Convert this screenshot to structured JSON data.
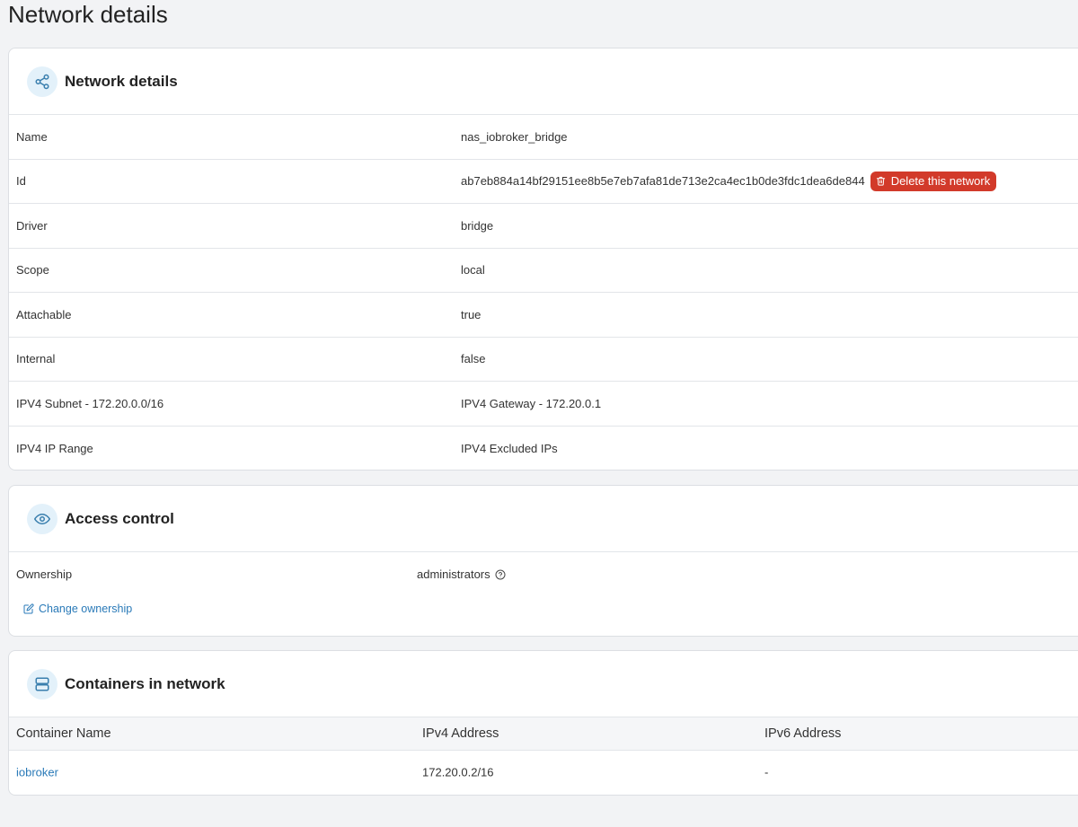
{
  "page": {
    "title": "Network details"
  },
  "network_details": {
    "title": "Network details",
    "icon": "share-nodes-icon",
    "rows": [
      {
        "key": "Name",
        "value": "nas_iobroker_bridge"
      },
      {
        "key": "Id",
        "value": "ab7eb884a14bf29151ee8b5e7eb7afa81de713e2ca4ec1b0de3fdc1dea6de844"
      },
      {
        "key": "Driver",
        "value": "bridge"
      },
      {
        "key": "Scope",
        "value": "local"
      },
      {
        "key": "Attachable",
        "value": "true"
      },
      {
        "key": "Internal",
        "value": "false"
      },
      {
        "key": "IPV4 Subnet - 172.20.0.0/16",
        "value": "IPV4 Gateway - 172.20.0.1"
      },
      {
        "key": "IPV4 IP Range",
        "value": "IPV4 Excluded IPs"
      }
    ],
    "delete_button_label": "Delete this network"
  },
  "access_control": {
    "title": "Access control",
    "icon": "eye-icon",
    "ownership_label": "Ownership",
    "ownership_value": "administrators",
    "change_ownership_label": "Change ownership"
  },
  "containers": {
    "title": "Containers in network",
    "icon": "server-stack-icon",
    "columns": [
      "Container Name",
      "IPv4 Address",
      "IPv6 Address"
    ],
    "rows": [
      {
        "name": "iobroker",
        "ipv4": "172.20.0.2/16",
        "ipv6": "-"
      }
    ]
  },
  "colors": {
    "accent": "#2a7ab8",
    "danger": "#d23a2a",
    "background": "#f2f3f5"
  }
}
